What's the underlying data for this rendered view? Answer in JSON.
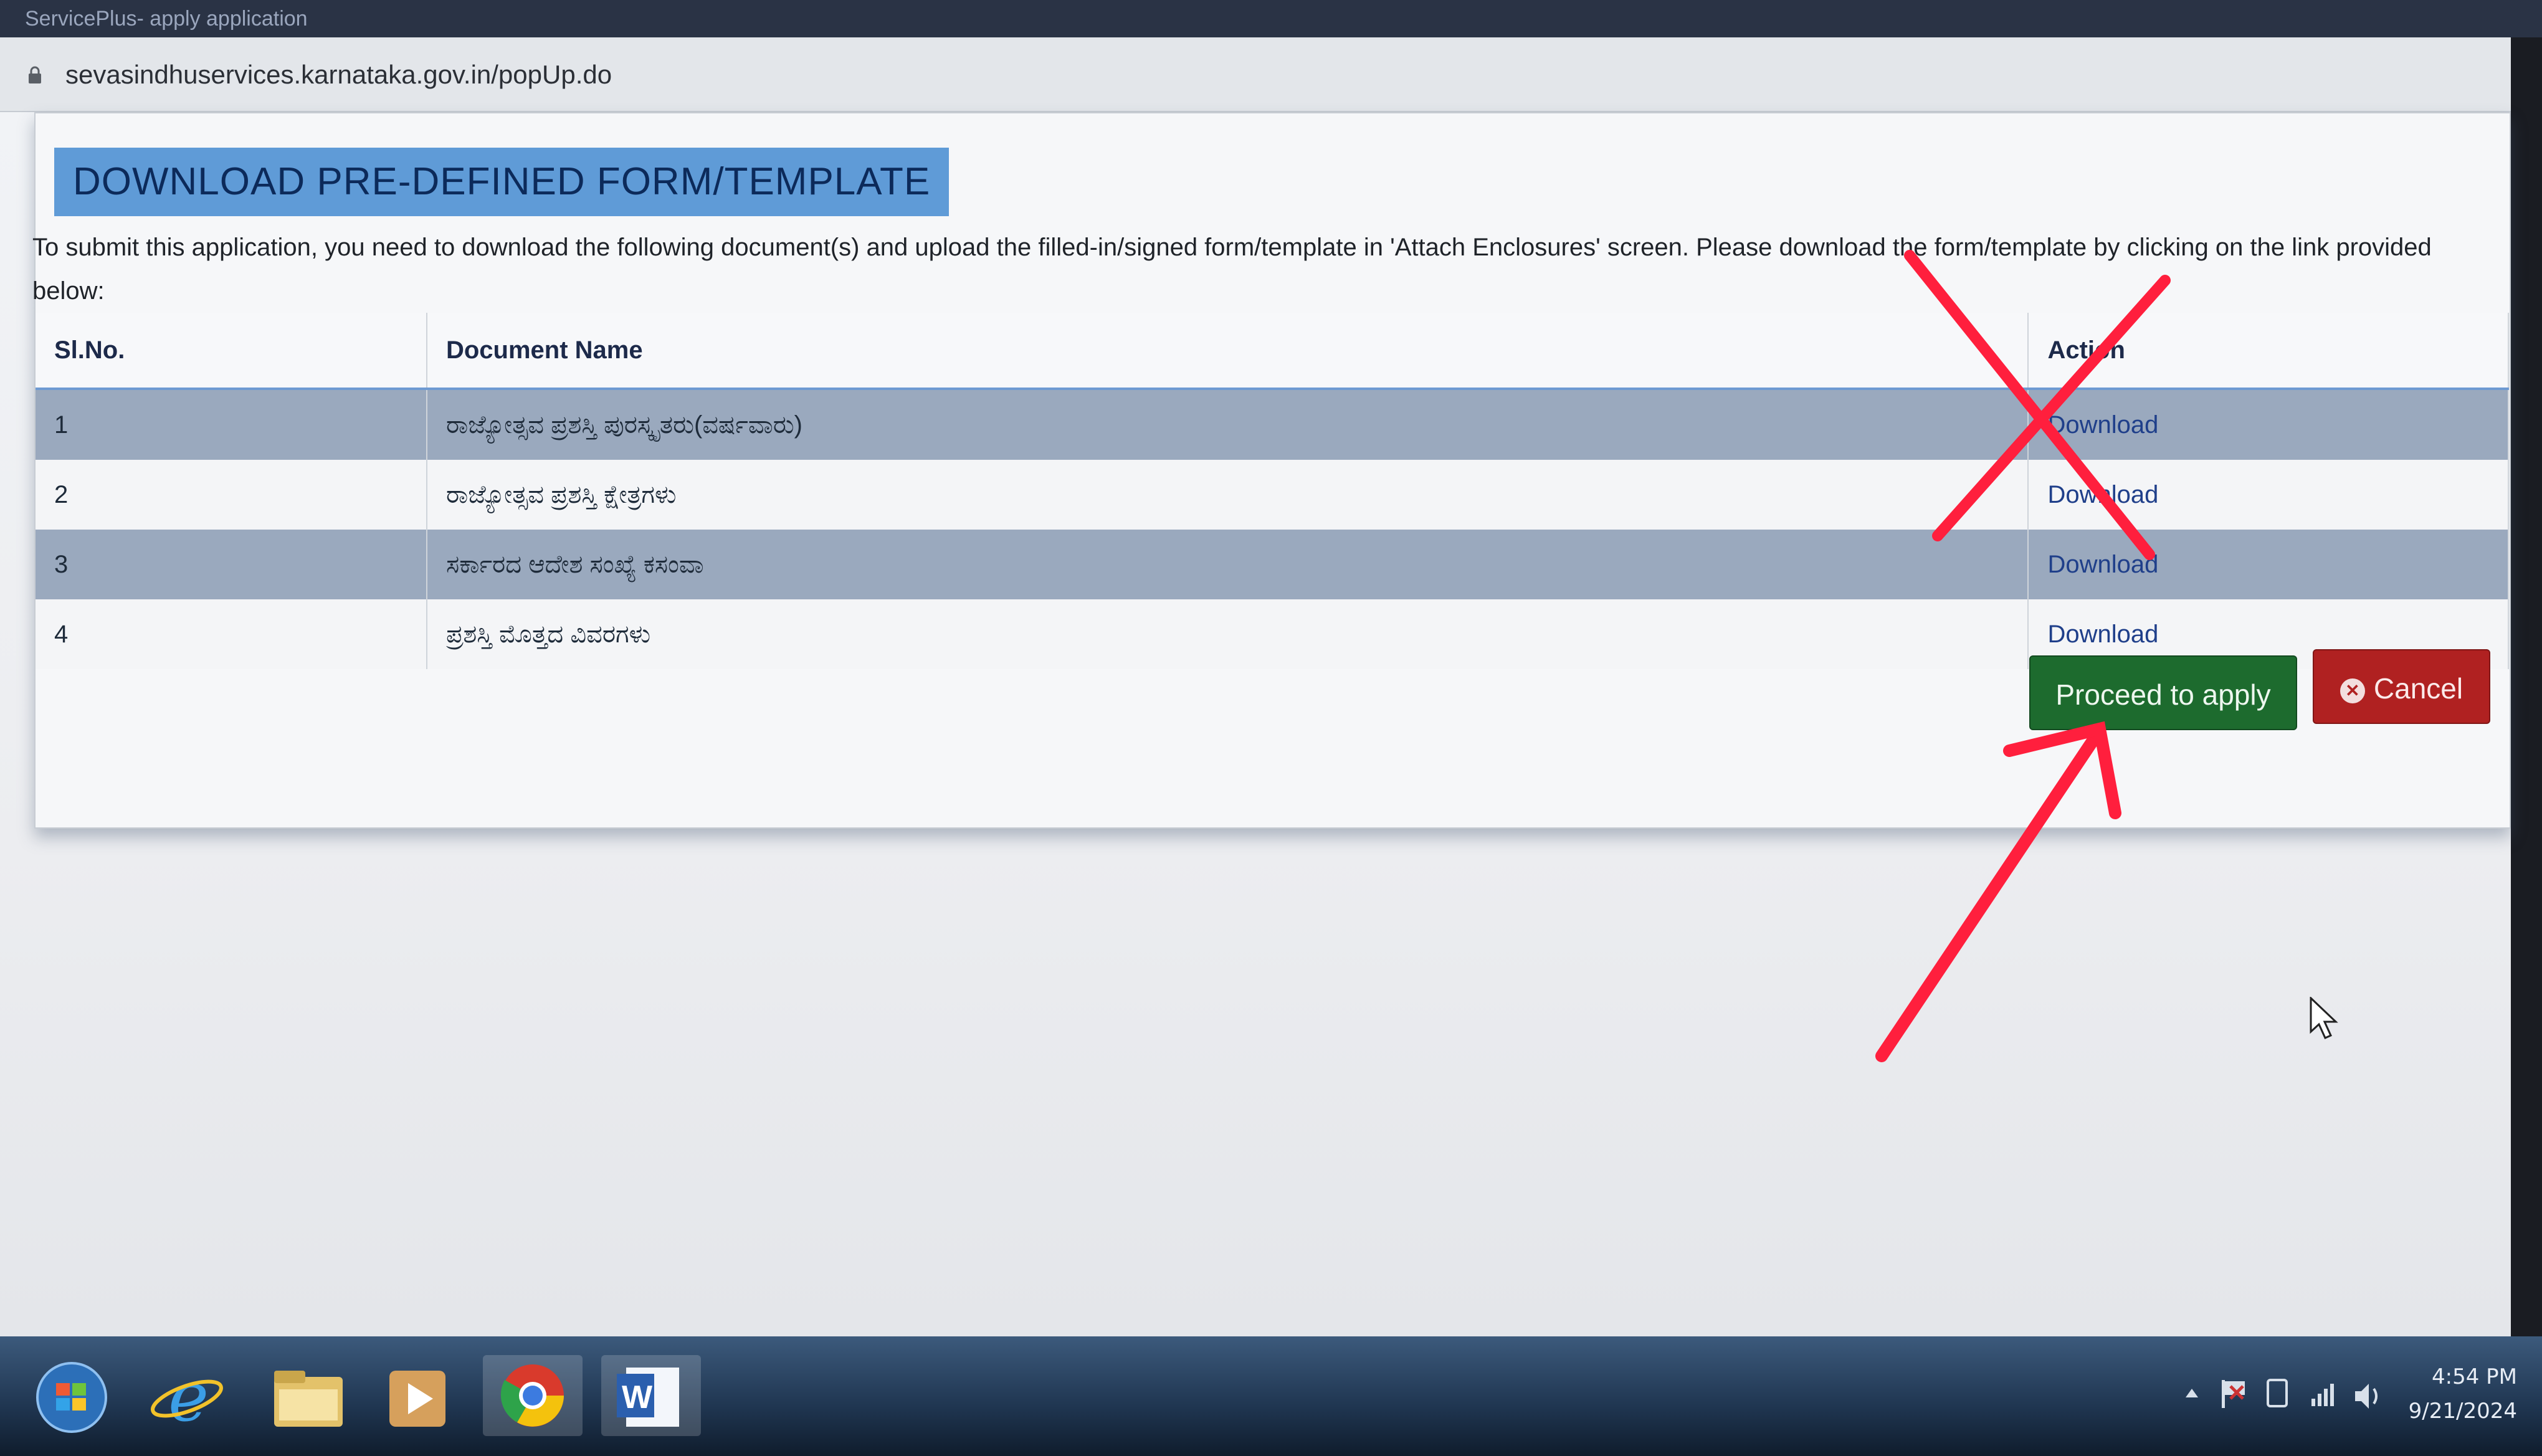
{
  "browser": {
    "title": "ServicePlus- apply application",
    "url": "sevasindhuservices.karnataka.gov.in/popUp.do"
  },
  "dialog": {
    "title": "DOWNLOAD PRE-DEFINED FORM/TEMPLATE",
    "instructions": "To submit this application, you need to download the following document(s) and upload the filled-in/signed form/template in 'Attach Enclosures' screen. Please download the form/template by clicking on the link provided below:",
    "table": {
      "headers": {
        "sl_no": "Sl.No.",
        "document_name": "Document Name",
        "action": "Action"
      },
      "rows": [
        {
          "sl": "1",
          "name": "ರಾಜ್ಯೋತ್ಸವ ಪ್ರಶಸ್ತಿ ಪುರಸ್ಕೃತರು(ವರ್ಷವಾರು)",
          "action": "Download"
        },
        {
          "sl": "2",
          "name": "ರಾಜ್ಯೋತ್ಸವ ಪ್ರಶಸ್ತಿ ಕ್ಷೇತ್ರಗಳು",
          "action": "Download"
        },
        {
          "sl": "3",
          "name": "ಸರ್ಕಾರದ ಆದೇಶ ಸಂಖ್ಯೆ ಕಸಂವಾ",
          "action": "Download"
        },
        {
          "sl": "4",
          "name": "ಪ್ರಶಸ್ತಿ ಮೊತ್ತದ ವಿವರಗಳು",
          "action": "Download"
        }
      ]
    },
    "buttons": {
      "proceed": "Proceed to apply",
      "cancel": "Cancel"
    }
  },
  "annotation": {
    "color": "#ff1f3d",
    "marks": [
      "cross-over-download-column",
      "arrow-to-proceed-button"
    ]
  },
  "taskbar": {
    "icons": [
      "windows-start-icon",
      "internet-explorer-icon",
      "file-explorer-icon",
      "media-player-icon",
      "chrome-icon",
      "word-icon"
    ],
    "clock_time": "4:54 PM",
    "clock_date": "9/21/2024"
  },
  "colors": {
    "title_bg": "#5f9bd7",
    "proceed_bg": "#1d6b2e",
    "cancel_bg": "#b02121",
    "row_odd": "#9aa9be"
  }
}
